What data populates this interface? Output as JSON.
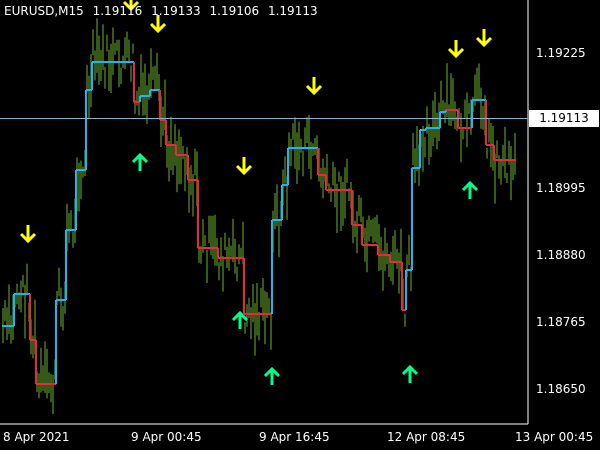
{
  "header": {
    "symbol": "EURUSD,M15",
    "open": "1.19116",
    "high": "1.19133",
    "low": "1.19106",
    "close": "1.19113"
  },
  "current_price": "1.19113",
  "price_axis": [
    "1.19225",
    "1.18995",
    "1.18880",
    "1.18765",
    "1.18650"
  ],
  "time_axis": [
    "8 Apr 2021",
    "9 Apr 00:45",
    "9 Apr 16:45",
    "12 Apr 08:45",
    "13 Apr 00:45"
  ],
  "colors": {
    "background": "#000000",
    "bars": "#6bb22e",
    "trail_up": "#1fb4f0",
    "trail_down": "#e8283c",
    "arrow_sell": "#ffff00",
    "arrow_buy": "#00ff88",
    "price_line": "#8fb3c8"
  },
  "icons": {
    "sell": "arrow-down-icon",
    "buy": "arrow-up-icon"
  }
}
